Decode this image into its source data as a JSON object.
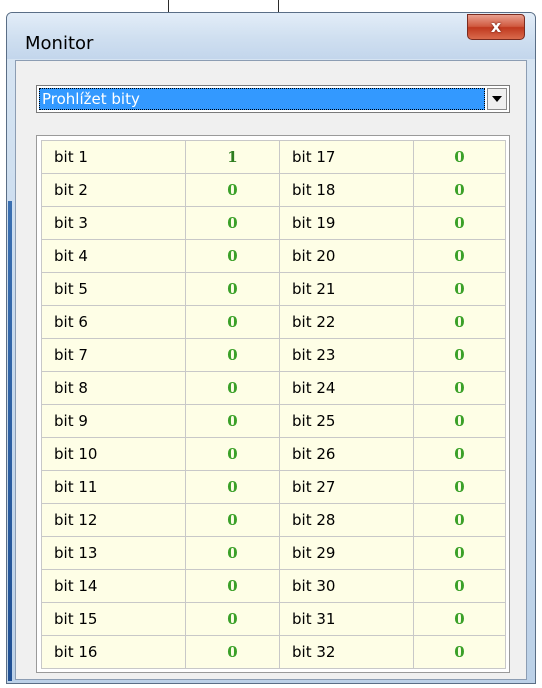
{
  "window": {
    "title": "Monitor",
    "close_glyph": "x"
  },
  "view_select": {
    "selected_option": "Prohlížet bity",
    "arrow_icon": "chevron-down-icon"
  },
  "bits": {
    "left_column": [
      {
        "label": "bit 1",
        "value": "1"
      },
      {
        "label": "bit 2",
        "value": "0"
      },
      {
        "label": "bit 3",
        "value": "0"
      },
      {
        "label": "bit 4",
        "value": "0"
      },
      {
        "label": "bit 5",
        "value": "0"
      },
      {
        "label": "bit 6",
        "value": "0"
      },
      {
        "label": "bit 7",
        "value": "0"
      },
      {
        "label": "bit 8",
        "value": "0"
      },
      {
        "label": "bit 9",
        "value": "0"
      },
      {
        "label": "bit 10",
        "value": "0"
      },
      {
        "label": "bit 11",
        "value": "0"
      },
      {
        "label": "bit 12",
        "value": "0"
      },
      {
        "label": "bit 13",
        "value": "0"
      },
      {
        "label": "bit 14",
        "value": "0"
      },
      {
        "label": "bit 15",
        "value": "0"
      },
      {
        "label": "bit 16",
        "value": "0"
      }
    ],
    "right_column": [
      {
        "label": "bit 17",
        "value": "0"
      },
      {
        "label": "bit 18",
        "value": "0"
      },
      {
        "label": "bit 19",
        "value": "0"
      },
      {
        "label": "bit 20",
        "value": "0"
      },
      {
        "label": "bit 21",
        "value": "0"
      },
      {
        "label": "bit 22",
        "value": "0"
      },
      {
        "label": "bit 23",
        "value": "0"
      },
      {
        "label": "bit 24",
        "value": "0"
      },
      {
        "label": "bit 25",
        "value": "0"
      },
      {
        "label": "bit 26",
        "value": "0"
      },
      {
        "label": "bit 27",
        "value": "0"
      },
      {
        "label": "bit 28",
        "value": "0"
      },
      {
        "label": "bit 29",
        "value": "0"
      },
      {
        "label": "bit 30",
        "value": "0"
      },
      {
        "label": "bit 31",
        "value": "0"
      },
      {
        "label": "bit 32",
        "value": "0"
      }
    ]
  },
  "colors": {
    "cell_background": "#fefee6",
    "value_text": "#3aa028",
    "selection_highlight": "#3399ff",
    "close_button": "#c7452a"
  }
}
